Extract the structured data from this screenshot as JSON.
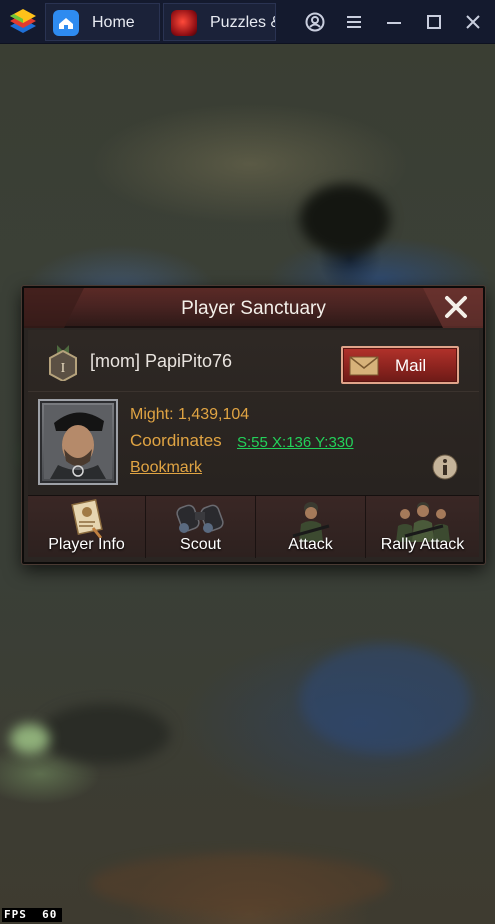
{
  "titlebar": {
    "tabs": [
      {
        "label": "Home",
        "icon": "home-icon"
      },
      {
        "label": "Puzzles &",
        "icon": "game-app-icon"
      }
    ],
    "controls": [
      "account-icon",
      "menu-icon",
      "minimize-icon",
      "maximize-icon",
      "close-icon"
    ]
  },
  "dialog": {
    "title": "Player Sanctuary",
    "player_name": "[mom] PapiPito76",
    "rank_badge": "I",
    "mail_label": "Mail",
    "might": "Might: 1,439,104",
    "coordinates_label": "Coordinates",
    "coordinates_value": "S:55  X:136  Y:330",
    "bookmark_label": "Bookmark",
    "actions": [
      {
        "label": "Player Info",
        "icon": "player-info-icon"
      },
      {
        "label": "Scout",
        "icon": "binoculars-icon"
      },
      {
        "label": "Attack",
        "icon": "soldier-icon"
      },
      {
        "label": "Rally Attack",
        "icon": "soldiers-group-icon"
      }
    ]
  },
  "status": {
    "fps_label": "FPS",
    "fps_value": "60"
  },
  "colors": {
    "title_bar": "#141a2e",
    "accent_gold": "#e0a443",
    "link_green": "#23d05a",
    "mail_red": "#a02a24"
  }
}
